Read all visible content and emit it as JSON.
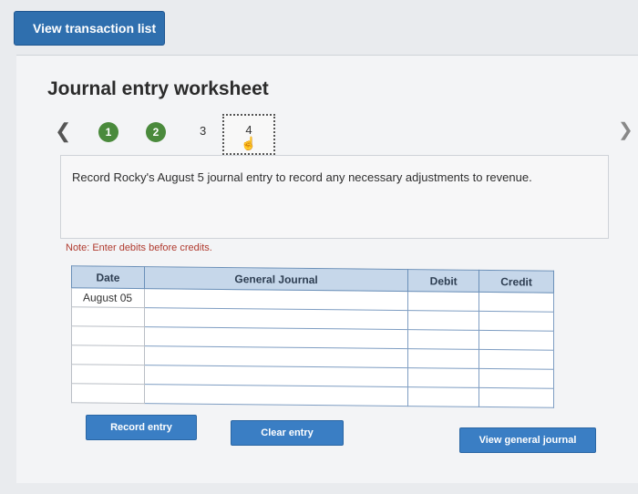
{
  "top_button": {
    "label": "View transaction list"
  },
  "worksheet": {
    "title": "Journal entry worksheet",
    "steps": [
      "1",
      "2",
      "3",
      "4"
    ],
    "prev_icon": "chevron-left-icon",
    "next_icon": "chevron-right-icon",
    "prompt": "Record Rocky's August 5 journal entry to record any necessary adjustments to revenue.",
    "note": "Note: Enter debits before credits."
  },
  "journal_table": {
    "headers": [
      "Date",
      "General Journal",
      "Debit",
      "Credit"
    ],
    "rows": [
      [
        "August 05",
        "",
        "",
        ""
      ],
      [
        "",
        "",
        "",
        ""
      ],
      [
        "",
        "",
        "",
        ""
      ],
      [
        "",
        "",
        "",
        ""
      ],
      [
        "",
        "",
        "",
        ""
      ],
      [
        "",
        "",
        "",
        ""
      ]
    ]
  },
  "actions": {
    "record": "Record entry",
    "clear": "Clear entry",
    "view_journal": "View general journal"
  },
  "colors": {
    "primary_button": "#3a7ec4",
    "step_complete": "#4a8a3c",
    "note_text": "#b03a2e",
    "table_header": "#c6d7ea"
  }
}
